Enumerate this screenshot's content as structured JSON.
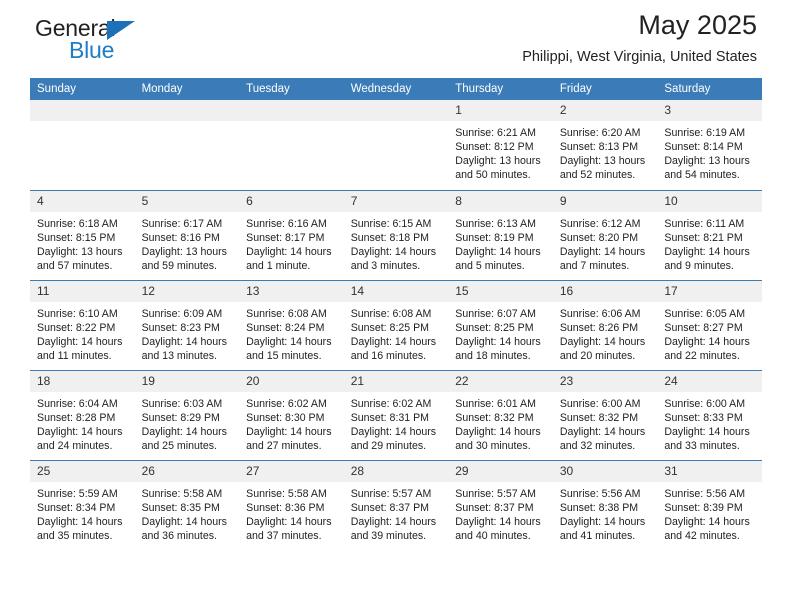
{
  "brand": {
    "name_top": "General",
    "name_bottom": "Blue",
    "accent_color": "#1f7dc4",
    "triangle_color": "#1c71b9"
  },
  "header": {
    "title": "May 2025",
    "subtitle": "Philippi, West Virginia, United States"
  },
  "theme": {
    "header_bg": "#3b7cb8",
    "header_text": "#ffffff",
    "daynum_bg": "#f0f0f0",
    "row_divider": "#3b7cb8"
  },
  "weekday_headers": [
    "Sunday",
    "Monday",
    "Tuesday",
    "Wednesday",
    "Thursday",
    "Friday",
    "Saturday"
  ],
  "weeks": [
    [
      {
        "day": "",
        "empty": true,
        "sunrise": "",
        "sunset": "",
        "daylight_line1": "",
        "daylight_line2": ""
      },
      {
        "day": "",
        "empty": true,
        "sunrise": "",
        "sunset": "",
        "daylight_line1": "",
        "daylight_line2": ""
      },
      {
        "day": "",
        "empty": true,
        "sunrise": "",
        "sunset": "",
        "daylight_line1": "",
        "daylight_line2": ""
      },
      {
        "day": "",
        "empty": true,
        "sunrise": "",
        "sunset": "",
        "daylight_line1": "",
        "daylight_line2": ""
      },
      {
        "day": "1",
        "empty": false,
        "sunrise": "Sunrise: 6:21 AM",
        "sunset": "Sunset: 8:12 PM",
        "daylight_line1": "Daylight: 13 hours",
        "daylight_line2": "and 50 minutes."
      },
      {
        "day": "2",
        "empty": false,
        "sunrise": "Sunrise: 6:20 AM",
        "sunset": "Sunset: 8:13 PM",
        "daylight_line1": "Daylight: 13 hours",
        "daylight_line2": "and 52 minutes."
      },
      {
        "day": "3",
        "empty": false,
        "sunrise": "Sunrise: 6:19 AM",
        "sunset": "Sunset: 8:14 PM",
        "daylight_line1": "Daylight: 13 hours",
        "daylight_line2": "and 54 minutes."
      }
    ],
    [
      {
        "day": "4",
        "empty": false,
        "sunrise": "Sunrise: 6:18 AM",
        "sunset": "Sunset: 8:15 PM",
        "daylight_line1": "Daylight: 13 hours",
        "daylight_line2": "and 57 minutes."
      },
      {
        "day": "5",
        "empty": false,
        "sunrise": "Sunrise: 6:17 AM",
        "sunset": "Sunset: 8:16 PM",
        "daylight_line1": "Daylight: 13 hours",
        "daylight_line2": "and 59 minutes."
      },
      {
        "day": "6",
        "empty": false,
        "sunrise": "Sunrise: 6:16 AM",
        "sunset": "Sunset: 8:17 PM",
        "daylight_line1": "Daylight: 14 hours",
        "daylight_line2": "and 1 minute."
      },
      {
        "day": "7",
        "empty": false,
        "sunrise": "Sunrise: 6:15 AM",
        "sunset": "Sunset: 8:18 PM",
        "daylight_line1": "Daylight: 14 hours",
        "daylight_line2": "and 3 minutes."
      },
      {
        "day": "8",
        "empty": false,
        "sunrise": "Sunrise: 6:13 AM",
        "sunset": "Sunset: 8:19 PM",
        "daylight_line1": "Daylight: 14 hours",
        "daylight_line2": "and 5 minutes."
      },
      {
        "day": "9",
        "empty": false,
        "sunrise": "Sunrise: 6:12 AM",
        "sunset": "Sunset: 8:20 PM",
        "daylight_line1": "Daylight: 14 hours",
        "daylight_line2": "and 7 minutes."
      },
      {
        "day": "10",
        "empty": false,
        "sunrise": "Sunrise: 6:11 AM",
        "sunset": "Sunset: 8:21 PM",
        "daylight_line1": "Daylight: 14 hours",
        "daylight_line2": "and 9 minutes."
      }
    ],
    [
      {
        "day": "11",
        "empty": false,
        "sunrise": "Sunrise: 6:10 AM",
        "sunset": "Sunset: 8:22 PM",
        "daylight_line1": "Daylight: 14 hours",
        "daylight_line2": "and 11 minutes."
      },
      {
        "day": "12",
        "empty": false,
        "sunrise": "Sunrise: 6:09 AM",
        "sunset": "Sunset: 8:23 PM",
        "daylight_line1": "Daylight: 14 hours",
        "daylight_line2": "and 13 minutes."
      },
      {
        "day": "13",
        "empty": false,
        "sunrise": "Sunrise: 6:08 AM",
        "sunset": "Sunset: 8:24 PM",
        "daylight_line1": "Daylight: 14 hours",
        "daylight_line2": "and 15 minutes."
      },
      {
        "day": "14",
        "empty": false,
        "sunrise": "Sunrise: 6:08 AM",
        "sunset": "Sunset: 8:25 PM",
        "daylight_line1": "Daylight: 14 hours",
        "daylight_line2": "and 16 minutes."
      },
      {
        "day": "15",
        "empty": false,
        "sunrise": "Sunrise: 6:07 AM",
        "sunset": "Sunset: 8:25 PM",
        "daylight_line1": "Daylight: 14 hours",
        "daylight_line2": "and 18 minutes."
      },
      {
        "day": "16",
        "empty": false,
        "sunrise": "Sunrise: 6:06 AM",
        "sunset": "Sunset: 8:26 PM",
        "daylight_line1": "Daylight: 14 hours",
        "daylight_line2": "and 20 minutes."
      },
      {
        "day": "17",
        "empty": false,
        "sunrise": "Sunrise: 6:05 AM",
        "sunset": "Sunset: 8:27 PM",
        "daylight_line1": "Daylight: 14 hours",
        "daylight_line2": "and 22 minutes."
      }
    ],
    [
      {
        "day": "18",
        "empty": false,
        "sunrise": "Sunrise: 6:04 AM",
        "sunset": "Sunset: 8:28 PM",
        "daylight_line1": "Daylight: 14 hours",
        "daylight_line2": "and 24 minutes."
      },
      {
        "day": "19",
        "empty": false,
        "sunrise": "Sunrise: 6:03 AM",
        "sunset": "Sunset: 8:29 PM",
        "daylight_line1": "Daylight: 14 hours",
        "daylight_line2": "and 25 minutes."
      },
      {
        "day": "20",
        "empty": false,
        "sunrise": "Sunrise: 6:02 AM",
        "sunset": "Sunset: 8:30 PM",
        "daylight_line1": "Daylight: 14 hours",
        "daylight_line2": "and 27 minutes."
      },
      {
        "day": "21",
        "empty": false,
        "sunrise": "Sunrise: 6:02 AM",
        "sunset": "Sunset: 8:31 PM",
        "daylight_line1": "Daylight: 14 hours",
        "daylight_line2": "and 29 minutes."
      },
      {
        "day": "22",
        "empty": false,
        "sunrise": "Sunrise: 6:01 AM",
        "sunset": "Sunset: 8:32 PM",
        "daylight_line1": "Daylight: 14 hours",
        "daylight_line2": "and 30 minutes."
      },
      {
        "day": "23",
        "empty": false,
        "sunrise": "Sunrise: 6:00 AM",
        "sunset": "Sunset: 8:32 PM",
        "daylight_line1": "Daylight: 14 hours",
        "daylight_line2": "and 32 minutes."
      },
      {
        "day": "24",
        "empty": false,
        "sunrise": "Sunrise: 6:00 AM",
        "sunset": "Sunset: 8:33 PM",
        "daylight_line1": "Daylight: 14 hours",
        "daylight_line2": "and 33 minutes."
      }
    ],
    [
      {
        "day": "25",
        "empty": false,
        "sunrise": "Sunrise: 5:59 AM",
        "sunset": "Sunset: 8:34 PM",
        "daylight_line1": "Daylight: 14 hours",
        "daylight_line2": "and 35 minutes."
      },
      {
        "day": "26",
        "empty": false,
        "sunrise": "Sunrise: 5:58 AM",
        "sunset": "Sunset: 8:35 PM",
        "daylight_line1": "Daylight: 14 hours",
        "daylight_line2": "and 36 minutes."
      },
      {
        "day": "27",
        "empty": false,
        "sunrise": "Sunrise: 5:58 AM",
        "sunset": "Sunset: 8:36 PM",
        "daylight_line1": "Daylight: 14 hours",
        "daylight_line2": "and 37 minutes."
      },
      {
        "day": "28",
        "empty": false,
        "sunrise": "Sunrise: 5:57 AM",
        "sunset": "Sunset: 8:37 PM",
        "daylight_line1": "Daylight: 14 hours",
        "daylight_line2": "and 39 minutes."
      },
      {
        "day": "29",
        "empty": false,
        "sunrise": "Sunrise: 5:57 AM",
        "sunset": "Sunset: 8:37 PM",
        "daylight_line1": "Daylight: 14 hours",
        "daylight_line2": "and 40 minutes."
      },
      {
        "day": "30",
        "empty": false,
        "sunrise": "Sunrise: 5:56 AM",
        "sunset": "Sunset: 8:38 PM",
        "daylight_line1": "Daylight: 14 hours",
        "daylight_line2": "and 41 minutes."
      },
      {
        "day": "31",
        "empty": false,
        "sunrise": "Sunrise: 5:56 AM",
        "sunset": "Sunset: 8:39 PM",
        "daylight_line1": "Daylight: 14 hours",
        "daylight_line2": "and 42 minutes."
      }
    ]
  ]
}
